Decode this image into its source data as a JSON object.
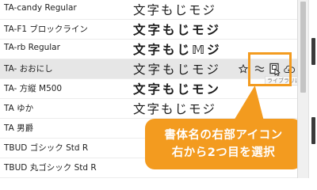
{
  "font_rows": [
    {
      "name": "TA-candy Regular",
      "sample": "文字もじモジ",
      "style": "hand"
    },
    {
      "name": "TA-F1 ブロックライン",
      "sample": "文字もじモジ",
      "style": "bold"
    },
    {
      "name": "TA-rb Regular",
      "sample": "文字もじ𝕄ジ",
      "style": "bold"
    },
    {
      "name": "TA- おおにし",
      "sample": "文字もじモジ",
      "style": "serif",
      "selected": true
    },
    {
      "name": "TA- 方縦 M500",
      "sample": "文字もじモン",
      "style": "bold"
    },
    {
      "name": "TA ゆか",
      "sample": "文字もじモジ",
      "style": "hand"
    },
    {
      "name": "TA 男爵",
      "sample": "",
      "style": "serif"
    },
    {
      "name": "TBUD ゴシック Std R",
      "sample": "",
      "style": "serif"
    },
    {
      "name": "TBUD 丸ゴシック Std R",
      "sample": "",
      "style": "serif"
    }
  ],
  "row_icons": {
    "star": "star-icon",
    "similar": "similar-fonts-icon",
    "library": "add-to-library-icon",
    "activate": "activate-cloud-icon"
  },
  "tooltip_text": "ライブラリに追加",
  "callout": {
    "line1": "書体名の右部アイコン",
    "line2": "右から2つ目を選択"
  },
  "colors": {
    "accent": "#f39b1f",
    "selected_row": "#e6e6e6",
    "callout_text": "#ffffff"
  }
}
